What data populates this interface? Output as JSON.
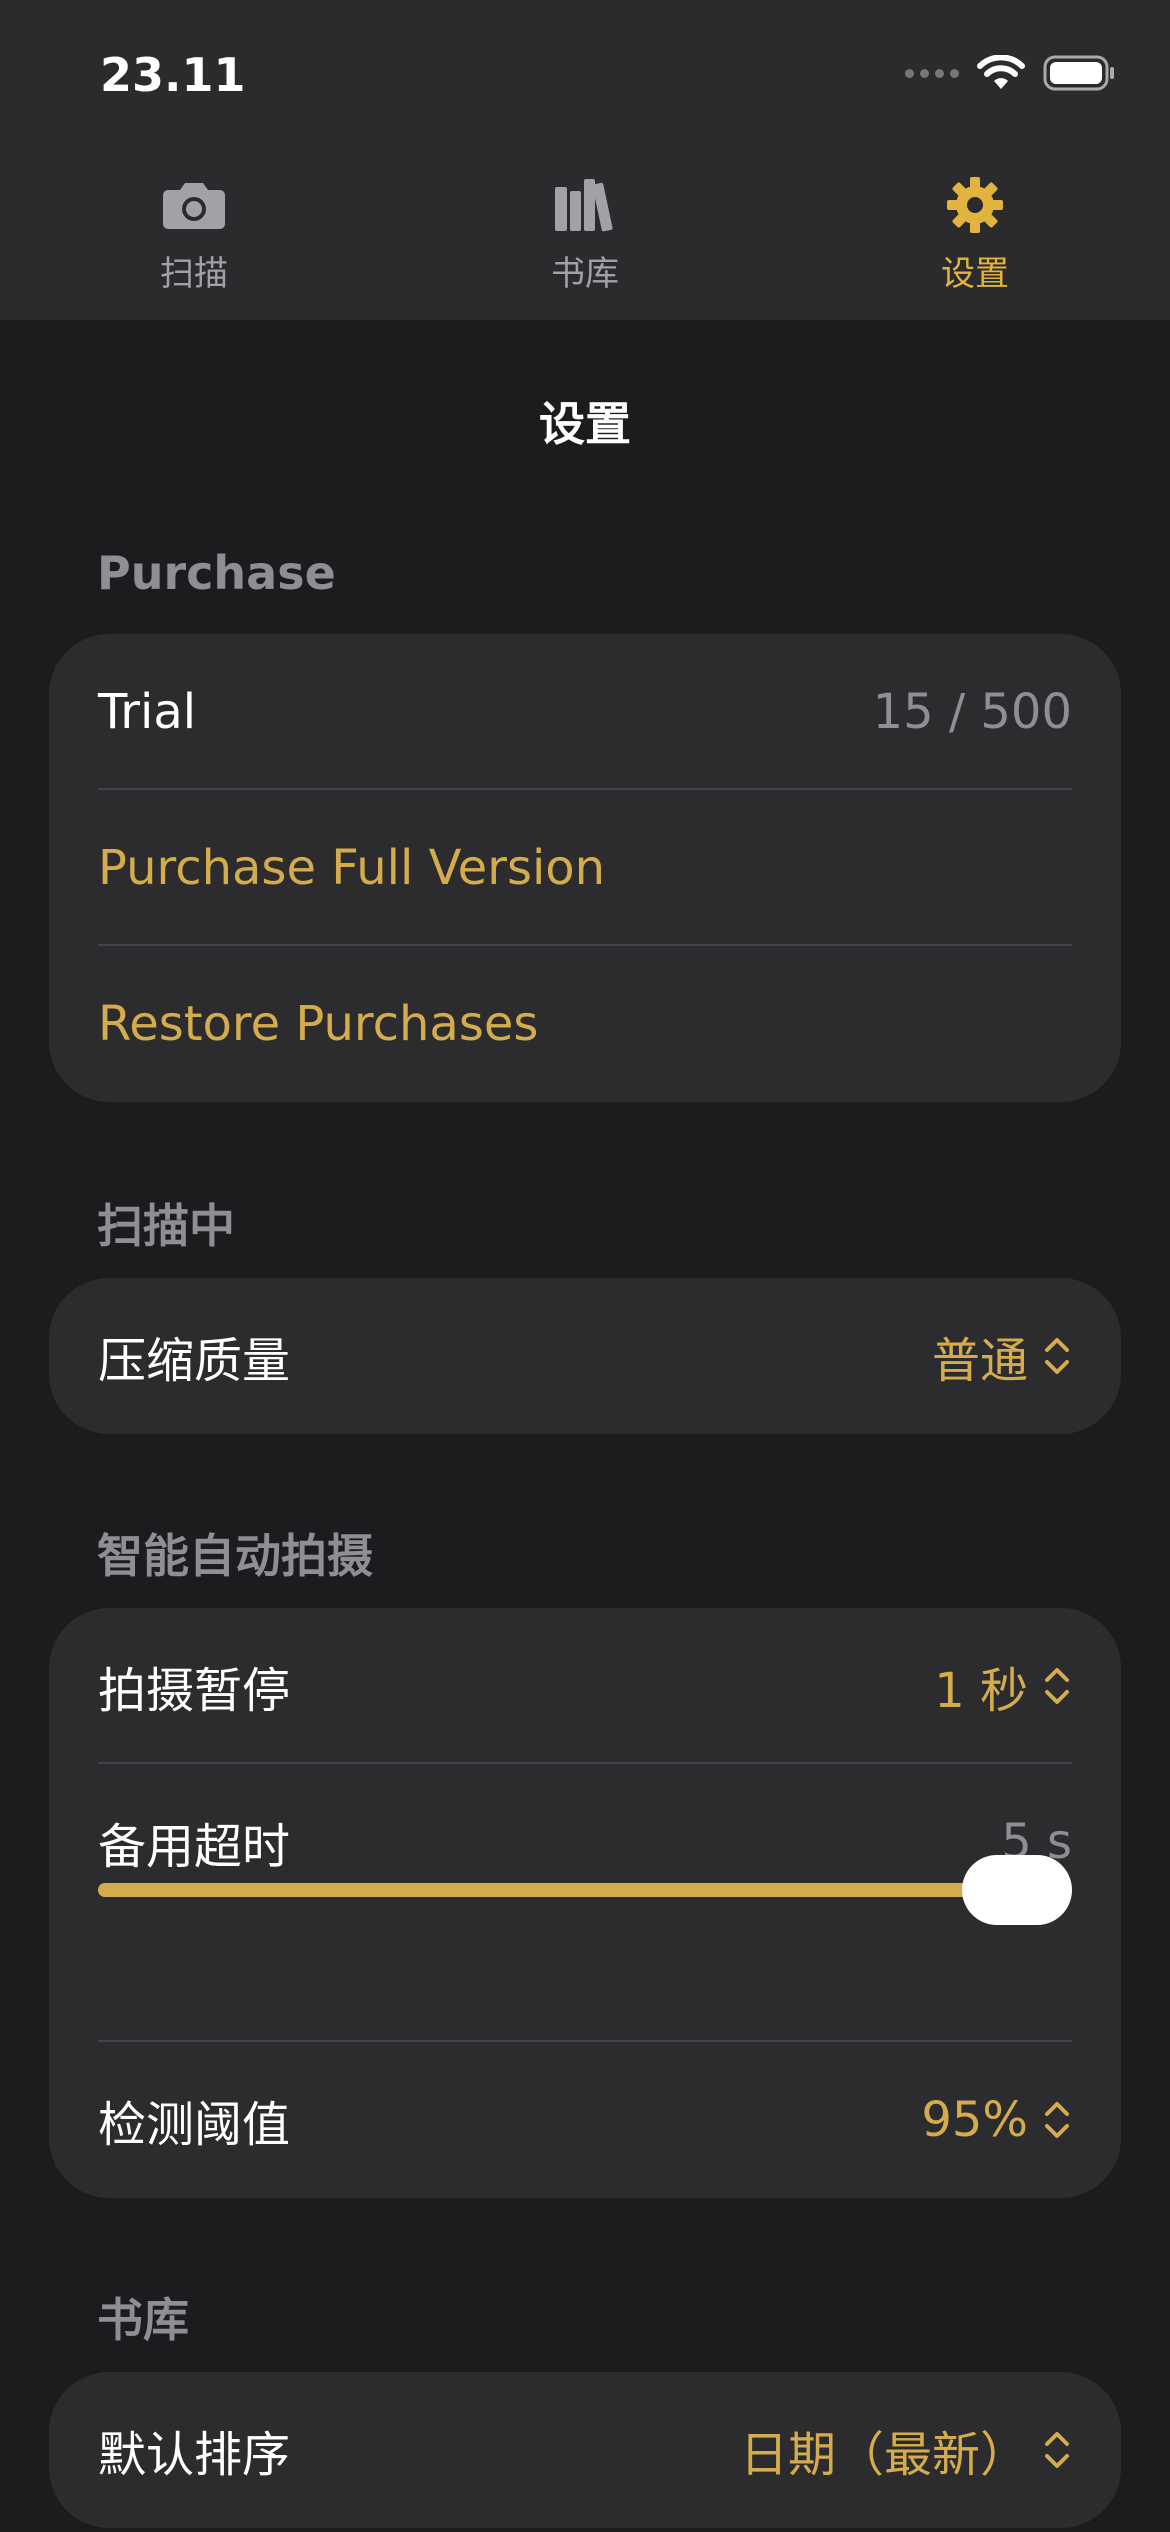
{
  "status": {
    "time": "23.11"
  },
  "tabs": [
    {
      "label": "扫描",
      "icon": "camera-icon"
    },
    {
      "label": "书库",
      "icon": "library-icon"
    },
    {
      "label": "设置",
      "icon": "gear-icon",
      "active": true
    }
  ],
  "title": "设置",
  "purchase": {
    "header": "Purchase",
    "trial_label": "Trial",
    "trial_value": "15 / 500",
    "full_version": "Purchase Full Version",
    "restore": "Restore Purchases"
  },
  "scanning": {
    "header": "扫描中",
    "compression_label": "压缩质量",
    "compression_value": "普通"
  },
  "auto_capture": {
    "header": "智能自动拍摄",
    "pause_label": "拍摄暂停",
    "pause_value": "1 秒",
    "timeout_label": "备用超时",
    "timeout_value": "5 s",
    "timeout_slider_fraction": 1.0,
    "threshold_label": "检测阈值",
    "threshold_value": "95%"
  },
  "library": {
    "header": "书库",
    "sort_label": "默认排序",
    "sort_value": "日期（最新）"
  },
  "colors": {
    "accent": "#d4ac4d",
    "background": "#1c1c1e",
    "card": "#2c2c2e"
  }
}
